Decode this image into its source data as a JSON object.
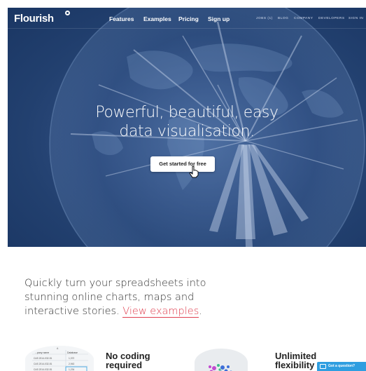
{
  "nav": {
    "logo": "Flourish",
    "main_links": [
      "Features",
      "Examples",
      "Pricing",
      "Sign up"
    ],
    "secondary_links": [
      "JOBS (1)",
      "BLOG",
      "COMPANY",
      "DEVELOPERS",
      "SIGN IN"
    ]
  },
  "hero": {
    "headline_line1": "Powerful, beautiful, easy",
    "headline_line2": "data visualisation.",
    "cta_label": "Get started for free"
  },
  "intro": {
    "text_before": "Quickly turn your spreadsheets into stunning online charts, maps and interactive stories.",
    "link": "View examples",
    "text_after": "."
  },
  "features": [
    {
      "title_line1": "No coding",
      "title_line2": "required"
    },
    {
      "title_line1": "Unlimited",
      "title_line2": "flexibility"
    }
  ],
  "spreadsheet_preview": {
    "headers": [
      "A",
      "...pany name",
      "Database"
    ],
    "rows": [
      [
        "CAS 2014-032-51",
        "1,372"
      ],
      [
        "CAS 2014-032-51",
        "2,943"
      ],
      [
        "CAS 2014-032-51",
        "1,234"
      ]
    ]
  },
  "chat": {
    "label": "Got a question?"
  },
  "colors": {
    "hero_bg": "#2f4d80",
    "link": "#e04050",
    "chat": "#2f9ee0"
  }
}
